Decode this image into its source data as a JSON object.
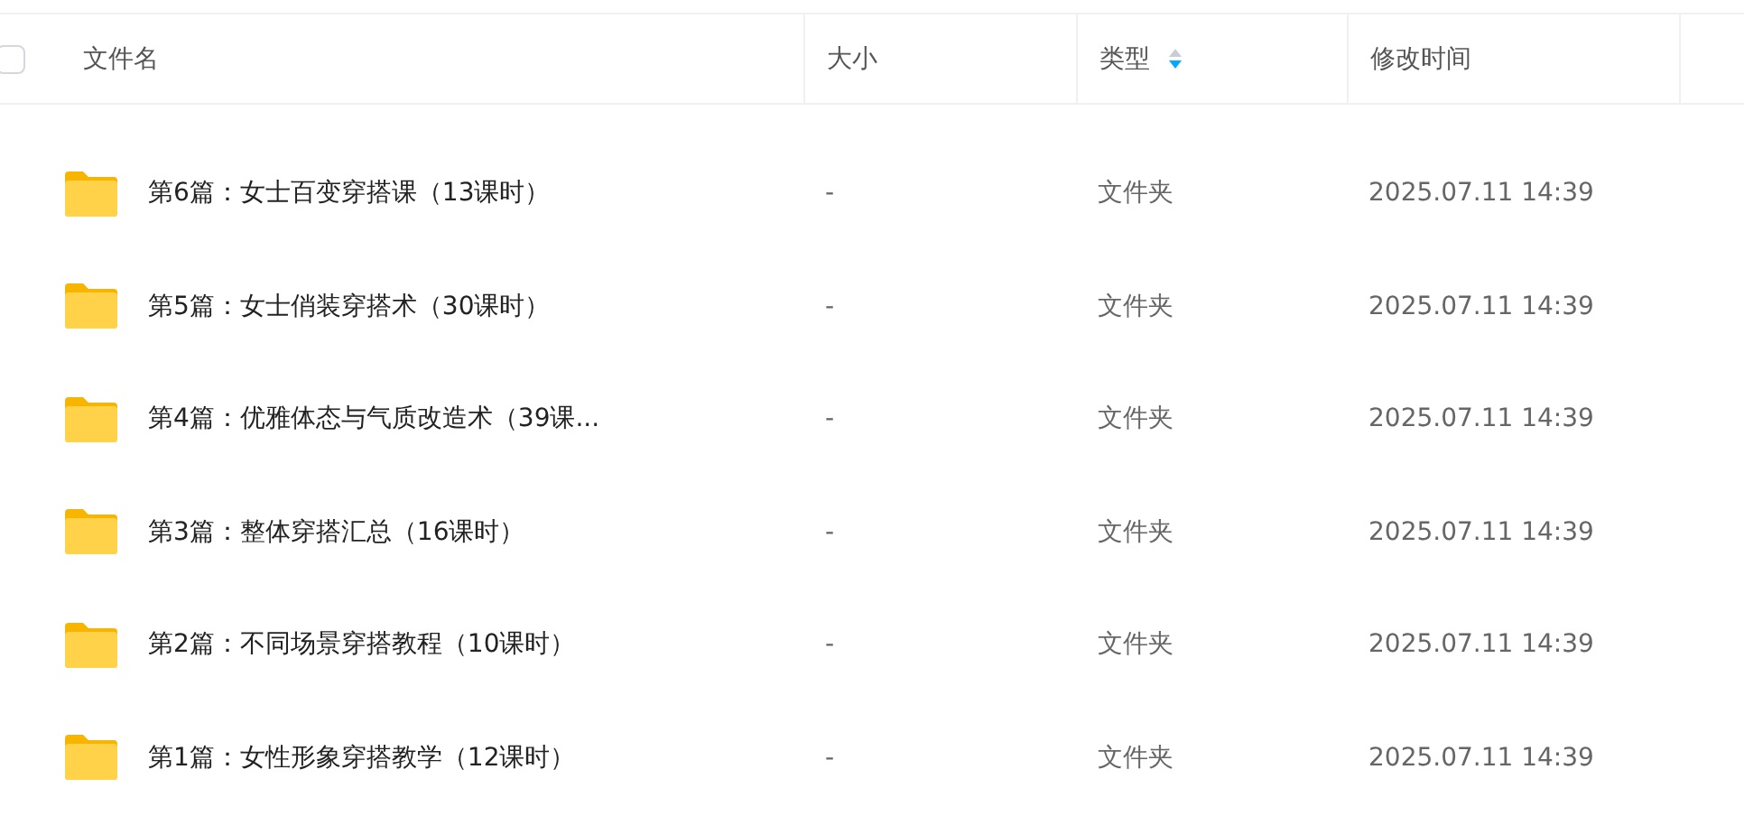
{
  "header": {
    "select_all": {
      "checked": false
    },
    "columns": [
      {
        "label": "文件名",
        "sorted": false
      },
      {
        "label": "大小",
        "sorted": false
      },
      {
        "label": "类型",
        "sorted": true,
        "descending": true
      },
      {
        "label": "修改时间",
        "sorted": false
      }
    ]
  },
  "rows": [
    {
      "name": "第6篇：女士百变穿搭课（13课时）",
      "size": "-",
      "type": "文件夹",
      "modified": "2025.07.11 14:39"
    },
    {
      "name": "第5篇：女士俏装穿搭术（30课时）",
      "size": "-",
      "type": "文件夹",
      "modified": "2025.07.11 14:39"
    },
    {
      "name": "第4篇：优雅体态与气质改造术（39课...",
      "size": "-",
      "type": "文件夹",
      "modified": "2025.07.11 14:39"
    },
    {
      "name": "第3篇：整体穿搭汇总（16课时）",
      "size": "-",
      "type": "文件夹",
      "modified": "2025.07.11 14:39"
    },
    {
      "name": "第2篇：不同场景穿搭教程（10课时）",
      "size": "-",
      "type": "文件夹",
      "modified": "2025.07.11 14:39"
    },
    {
      "name": "第1篇：女性形象穿搭教学（12课时）",
      "size": "-",
      "type": "文件夹",
      "modified": "2025.07.11 14:39"
    }
  ]
}
